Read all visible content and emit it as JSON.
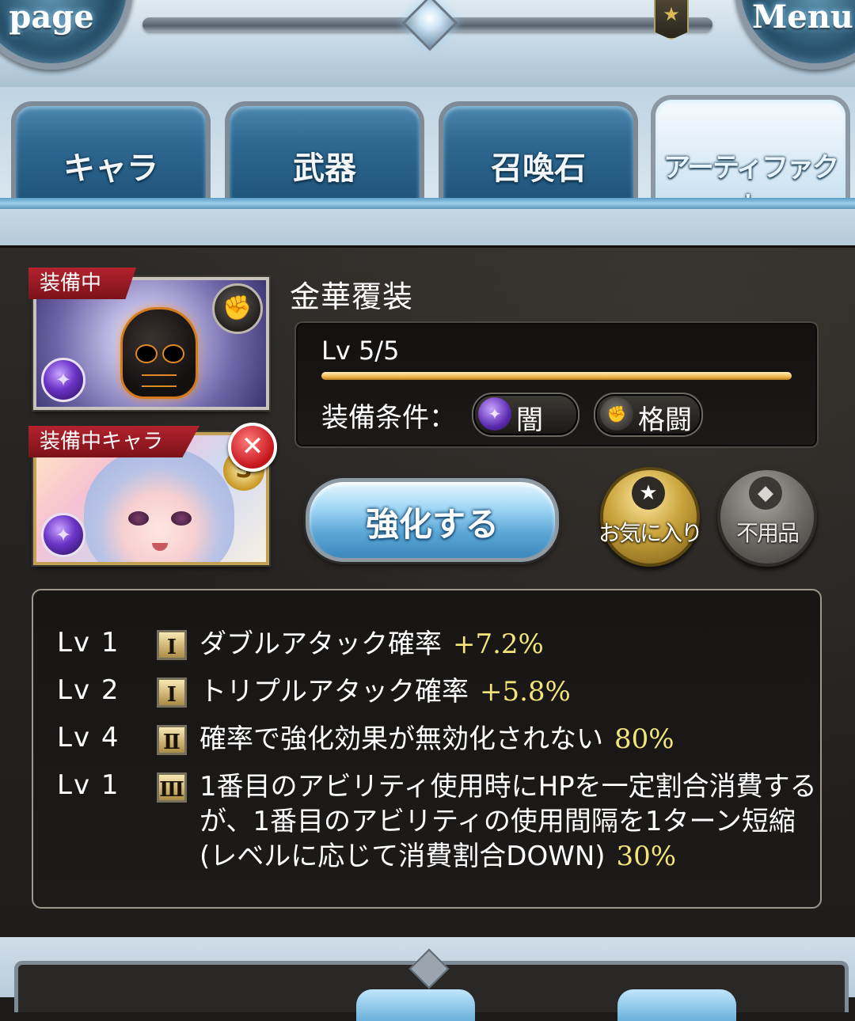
{
  "header": {
    "left_orb_label": "page",
    "right_orb_label": "Menu",
    "star_icon": "★"
  },
  "tabs": [
    {
      "label": "キャラ",
      "active": false
    },
    {
      "label": "武器",
      "active": false
    },
    {
      "label": "召喚石",
      "active": false
    },
    {
      "label": "アーティファクト",
      "active": true
    }
  ],
  "artifact": {
    "equipped_banner": "装備中",
    "name": "金華覆装",
    "level_text": "Lv 5/5",
    "level_progress_percent": 100,
    "weapon_icon": "fist-icon",
    "element_icon": "dark-element-icon",
    "equip_condition_label": "装備条件：",
    "conditions": [
      {
        "label": "闇",
        "icon": "dark-element-icon"
      },
      {
        "label": "格闘",
        "icon": "fist-icon"
      }
    ]
  },
  "character": {
    "equipped_banner": "装備中キャラ",
    "rarity": "S",
    "remove_icon": "✕"
  },
  "actions": {
    "enhance_label": "強化する",
    "favorite_label": "お気に入り",
    "junk_label": "不用品",
    "favorite_icon": "★",
    "junk_icon": "◆"
  },
  "skills": [
    {
      "level": "Lv 1",
      "tier": "Ⅰ",
      "text": "ダブルアタック確率",
      "value": "+7.2%"
    },
    {
      "level": "Lv 2",
      "tier": "Ⅰ",
      "text": "トリプルアタック確率",
      "value": "+5.8%"
    },
    {
      "level": "Lv 4",
      "tier": "Ⅱ",
      "text": "確率で強化効果が無効化されない",
      "value": "80%"
    },
    {
      "level": "Lv 1",
      "tier": "Ⅲ",
      "text": "1番目のアビリティ使用時にHPを一定割合消費するが、1番目のアビリティの使用間隔を1ターン短縮(レベルに応じて消費割合DOWN)",
      "value": "30%"
    }
  ],
  "colors": {
    "accent_gold": "#f3e57a",
    "tab_blue": "#2e6891",
    "banner_red": "#b3232d",
    "dark_element": "#6b34c7"
  }
}
